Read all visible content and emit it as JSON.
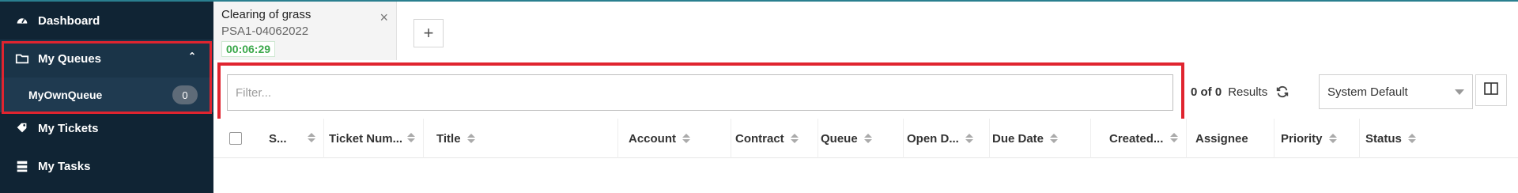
{
  "sidebar": {
    "dashboard": "Dashboard",
    "my_queues": "My Queues",
    "queue_item": {
      "label": "MyOwnQueue",
      "count": "0"
    },
    "my_tickets": "My Tickets",
    "my_tasks": "My Tasks"
  },
  "tab": {
    "title": "Clearing of grass",
    "subtitle": "PSA1-04062022",
    "timer": "00:06:29",
    "close": "×",
    "add": "+"
  },
  "filter": {
    "placeholder": "Filter...",
    "value": ""
  },
  "results": {
    "count": "0 of 0",
    "label": "Results"
  },
  "view_select": {
    "value": "System Default"
  },
  "table": {
    "columns": [
      "S...",
      "Ticket Num...",
      "Title",
      "Account",
      "Contract",
      "Queue",
      "Open D...",
      "Due Date",
      "Created...",
      "Assignee",
      "Priority",
      "Status"
    ]
  },
  "icons": {
    "dashboard": "dashboard-icon",
    "queues": "folder-icon",
    "tickets": "tickets-icon",
    "tasks": "tasks-icon",
    "refresh": "refresh-icon",
    "columns": "columns-icon"
  },
  "colors": {
    "sidebar_bg": "#102434",
    "highlight_border": "#e0242f",
    "timer_green": "#3aa84a"
  }
}
